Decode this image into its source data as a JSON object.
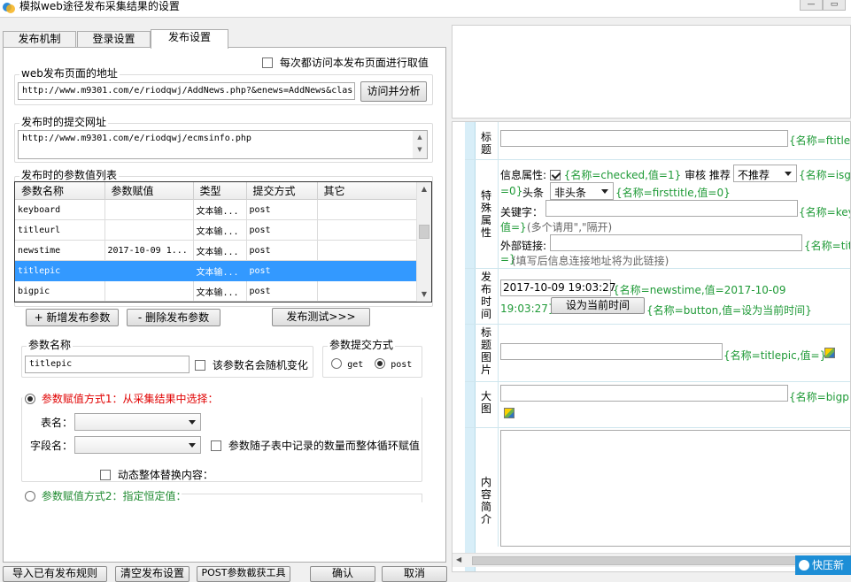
{
  "window": {
    "title": "模拟web途径发布采集结果的设置"
  },
  "tabs": [
    "发布机制",
    "登录设置",
    "发布设置"
  ],
  "publish_page": {
    "checkbox_label": "每次都访问本发布页面进行取值",
    "url_group_label": "web发布页面的地址",
    "url_value": "http://www.m9301.com/e/riodqwj/AddNews.php?&enews=AddNews&clas",
    "analyze_button": "访问并分析",
    "submit_group_label": "发布时的提交网址",
    "submit_value": "http://www.m9301.com/e/riodqwj/ecmsinfo.php",
    "params_group_label": "发布时的参数值列表"
  },
  "param_table": {
    "columns": [
      "参数名称",
      "参数赋值",
      "类型",
      "提交方式",
      "其它"
    ],
    "rows": [
      [
        "keyboard",
        "",
        "文本输...",
        "post",
        ""
      ],
      [
        "titleurl",
        "",
        "文本输...",
        "post",
        ""
      ],
      [
        "newstime",
        "2017-10-09 1...",
        "文本输...",
        "post",
        ""
      ],
      [
        "titlepic",
        "",
        "文本输...",
        "post",
        ""
      ],
      [
        "bigpic",
        "",
        "文本输...",
        "post",
        ""
      ]
    ],
    "selected_row": 3
  },
  "param_buttons": {
    "add": "+ 新增发布参数",
    "delete": "- 删除发布参数",
    "test": "发布测试>>>"
  },
  "param_name_group": {
    "label": "参数名称",
    "value": "titlepic",
    "random_checkbox": "该参数名会随机变化"
  },
  "submit_method_group": {
    "label": "参数提交方式",
    "get": "get",
    "post": "post",
    "selected": "post"
  },
  "assign_mode1": {
    "label": "参数赋值方式1：从采集结果中选择：",
    "table_label": "表名：",
    "field_label": "字段名：",
    "loop_checkbox": "参数随子表中记录的数量而整体循环赋值",
    "dynamic_checkbox": "动态整体替换内容："
  },
  "assign_mode2": {
    "label": "参数赋值方式2：指定恒定值："
  },
  "bottom_buttons": [
    "导入已有发布规则",
    "清空发布设置",
    "POST参数截获工具",
    "确认",
    "取消"
  ],
  "preview": {
    "title_label": "标题",
    "title_tag": "{名称=ftitle,",
    "special_label": "特殊属性",
    "info_attr_label": "信息属性:",
    "checked_tag": "{名称=checked,值=1}",
    "audit_label": "审核",
    "recommend_label": "推荐",
    "recommend_value": "不推荐",
    "isgood_tag_1": "{名称=isgo",
    "isgood_tag_2": "=0}",
    "headline_label": "头条",
    "headline_value": "非头条",
    "firsttitle_tag": "{名称=firsttitle,值=0}",
    "keyword_label": "关键字：",
    "keyword_tag_1": "{名称=keyb",
    "keyword_tag_2": "值=}",
    "keyword_hint": "(多个请用\",\"隔开)",
    "external_label": "外部链接:",
    "external_tag_1": "{名称=titl",
    "external_tag_2": "=}",
    "external_hint": "(填写后信息连接地址将为此链接)",
    "time_label": "发布时间",
    "time_value": "2017-10-09 19:03:27",
    "time_tag_1": "{名称=newstime,值=2017-10-09",
    "time_tag_2": "19:03:27}",
    "set_now_button": "设为当前时间",
    "button_tag": "{名称=button,值=设为当前时间}",
    "titlepic_label": "标题图片",
    "titlepic_tag": "{名称=titlepic,值=}",
    "bigpic_label": "大图",
    "bigpic_tag": "{名称=bigpic",
    "summary_label": "内容简介"
  },
  "tray": {
    "label": "快压新"
  }
}
